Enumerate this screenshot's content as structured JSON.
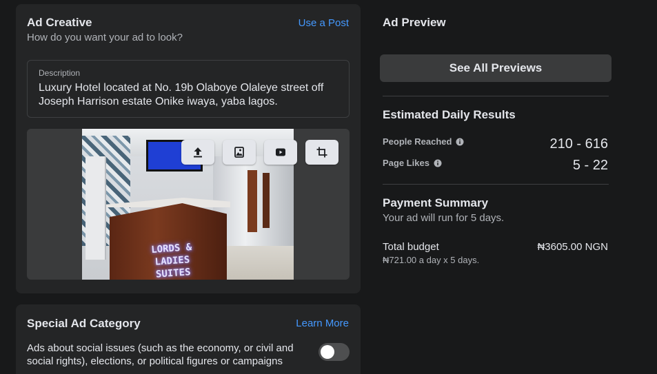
{
  "ad_creative": {
    "title": "Ad Creative",
    "subtitle": "How do you want your ad to look?",
    "use_post_link": "Use a Post",
    "description": {
      "label": "Description",
      "value": "Luxury Hotel located at No. 19b Olaboye Olaleye street off Joseph Harrison estate Onike iwaya, yaba lagos."
    },
    "media": {
      "sign_text_line1": "LORDS & LADIES",
      "sign_text_line2": "SUITES",
      "buttons": [
        {
          "icon": "upload-icon"
        },
        {
          "icon": "image-icon"
        },
        {
          "icon": "video-icon"
        },
        {
          "icon": "crop-icon"
        }
      ]
    }
  },
  "special_ad_category": {
    "title": "Special Ad Category",
    "learn_more_link": "Learn More",
    "text": "Ads about social issues (such as the economy, or civil and social rights), elections, or political figures or campaigns",
    "toggle_on": false
  },
  "ad_preview": {
    "title": "Ad Preview",
    "see_all_button": "See All Previews"
  },
  "estimated_results": {
    "title": "Estimated Daily Results",
    "metrics": [
      {
        "label": "People Reached",
        "value": "210 - 616"
      },
      {
        "label": "Page Likes",
        "value": "5 - 22"
      }
    ]
  },
  "payment_summary": {
    "title": "Payment Summary",
    "subtitle": "Your ad will run for 5 days.",
    "total_label": "Total budget",
    "total_value": "₦3605.00 NGN",
    "detail": "₦721.00 a day x 5 days."
  },
  "colors": {
    "background": "#18191a",
    "card": "#242526",
    "link": "#4599ff",
    "button": "#3a3b3c"
  }
}
